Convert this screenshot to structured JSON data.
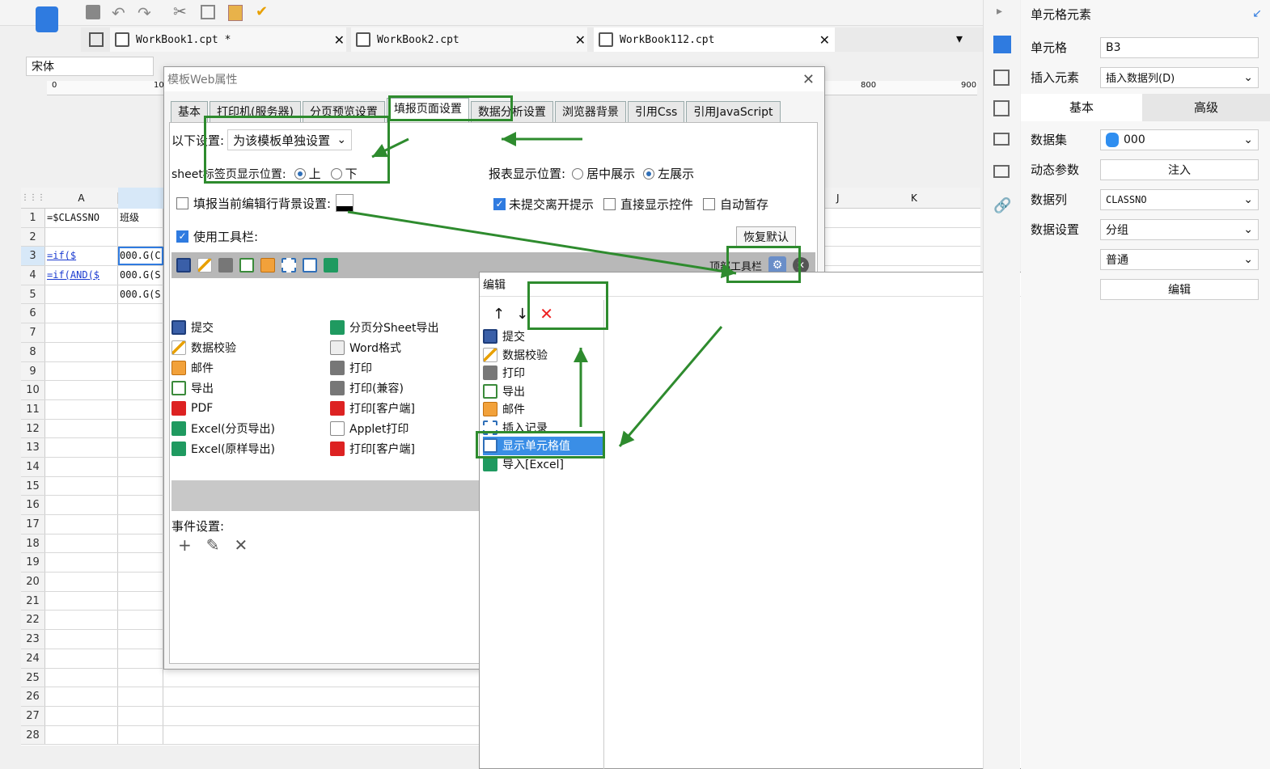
{
  "toolbar": {
    "font_name": "宋体",
    "tabs": [
      {
        "label": "WorkBook1.cpt *"
      },
      {
        "label": "WorkBook2.cpt"
      },
      {
        "label": "WorkBook112.cpt"
      }
    ]
  },
  "sheet": {
    "col_a": "A",
    "col_j": "J",
    "col_k": "K",
    "ruler": {
      "r0": "0",
      "r10": "10",
      "r800": "800",
      "r900": "900"
    },
    "rows": [
      {
        "n": "1",
        "a": "=$CLASSNO",
        "b": "班级"
      },
      {
        "n": "2",
        "a": "",
        "b": ""
      },
      {
        "n": "3",
        "a": "=if($",
        "b": "000.G(C"
      },
      {
        "n": "4",
        "a": "=if(AND($",
        "b": "000.G(S"
      },
      {
        "n": "5",
        "a": "",
        "b": "000.G(S"
      },
      {
        "n": "6"
      },
      {
        "n": "7"
      },
      {
        "n": "8"
      },
      {
        "n": "9"
      },
      {
        "n": "10"
      },
      {
        "n": "11"
      },
      {
        "n": "12"
      },
      {
        "n": "13"
      },
      {
        "n": "14"
      },
      {
        "n": "15"
      },
      {
        "n": "16"
      },
      {
        "n": "17"
      },
      {
        "n": "18"
      },
      {
        "n": "19"
      },
      {
        "n": "20"
      },
      {
        "n": "21"
      },
      {
        "n": "22"
      },
      {
        "n": "23"
      },
      {
        "n": "24"
      },
      {
        "n": "25"
      },
      {
        "n": "26"
      },
      {
        "n": "27"
      },
      {
        "n": "28"
      }
    ]
  },
  "web_dialog": {
    "title": "模板Web属性",
    "tabs": [
      {
        "label": "基本"
      },
      {
        "label": "打印机(服务器)"
      },
      {
        "label": "分页预览设置"
      },
      {
        "label": "填报页面设置"
      },
      {
        "label": "数据分析设置"
      },
      {
        "label": "浏览器背景"
      },
      {
        "label": "引用Css"
      },
      {
        "label": "引用JavaScript"
      }
    ],
    "setting_label": "以下设置:",
    "setting_value": "为该模板单独设置",
    "sheet_pos_label": "sheet标签页显示位置:",
    "sheet_pos_top": "上",
    "sheet_pos_bottom": "下",
    "report_pos_label": "报表显示位置:",
    "report_pos_center": "居中展示",
    "report_pos_left": "左展示",
    "row_bg_label": "填报当前编辑行背景设置:",
    "unsubmitted_label": "未提交离开提示",
    "direct_widget_label": "直接显示控件",
    "autosave_label": "自动暂存",
    "use_toolbar_label": "使用工具栏:",
    "restore_default": "恢复默认",
    "top_toolbar_label": "顶部工具栏",
    "items_left": [
      {
        "label": "提交"
      },
      {
        "label": "数据校验"
      },
      {
        "label": "邮件"
      },
      {
        "label": "导出"
      },
      {
        "label": "PDF"
      },
      {
        "label": "Excel(分页导出)"
      },
      {
        "label": "Excel(原样导出)"
      }
    ],
    "items_right": [
      {
        "label": "分页分Sheet导出"
      },
      {
        "label": "Word格式"
      },
      {
        "label": "打印"
      },
      {
        "label": "打印(兼容)"
      },
      {
        "label": "打印[客户端]"
      },
      {
        "label": "Applet打印"
      },
      {
        "label": "打印[客户端]"
      }
    ],
    "event_label": "事件设置:"
  },
  "edit_dialog": {
    "title": "编辑",
    "items": [
      {
        "label": "提交"
      },
      {
        "label": "数据校验"
      },
      {
        "label": "打印"
      },
      {
        "label": "导出"
      },
      {
        "label": "邮件"
      },
      {
        "label": "插入记录"
      },
      {
        "label": "显示单元格值"
      },
      {
        "label": "导入[Excel]"
      }
    ]
  },
  "right_panel": {
    "title": "单元格元素",
    "cell_label": "单元格",
    "cell_value": "B3",
    "insert_label": "插入元素",
    "insert_value": "插入数据列(D)",
    "tab_basic": "基本",
    "tab_advanced": "高级",
    "dataset_label": "数据集",
    "dataset_value": "000",
    "dynparam_label": "动态参数",
    "dynparam_button": "注入",
    "datacol_label": "数据列",
    "datacol_value": "CLASSNO",
    "dataset_setting_label": "数据设置",
    "dataset_setting_value": "分组",
    "mode_value": "普通",
    "edit_button": "编辑"
  }
}
